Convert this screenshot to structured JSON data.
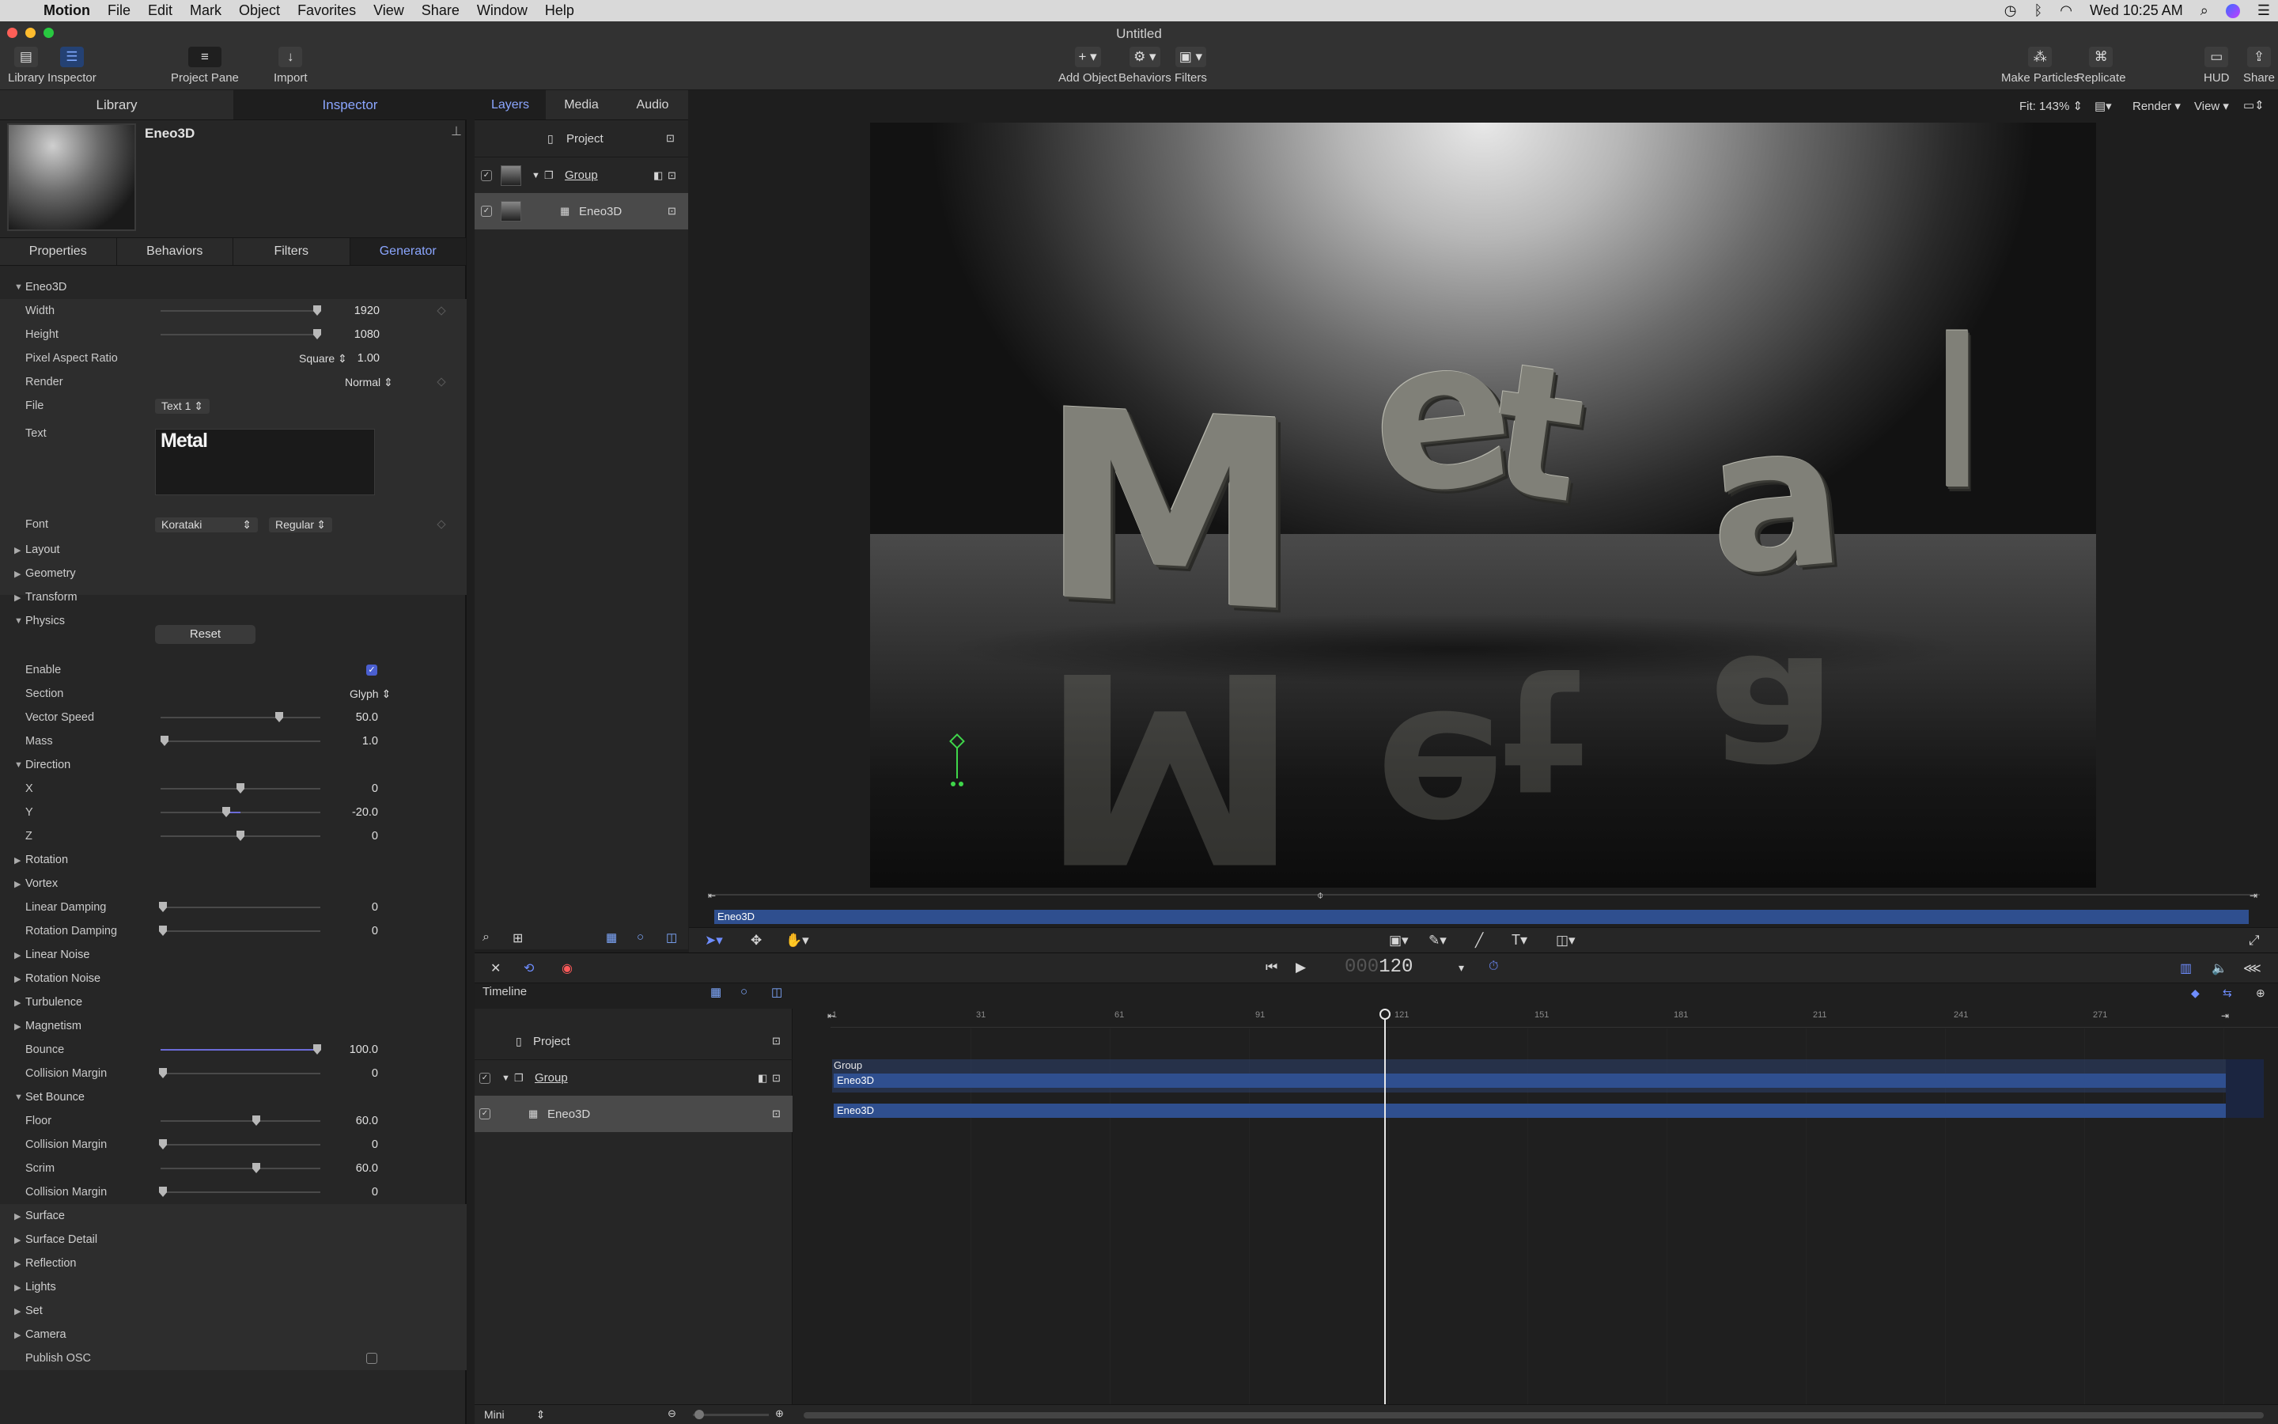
{
  "menubar": {
    "app_name": "Motion",
    "items": [
      "File",
      "Edit",
      "Mark",
      "Object",
      "Favorites",
      "View",
      "Share",
      "Window",
      "Help"
    ],
    "clock": "Wed 10:25 AM"
  },
  "window": {
    "title": "Untitled"
  },
  "toolbar": {
    "library": "Library",
    "inspector": "Inspector",
    "project_pane": "Project Pane",
    "import": "Import",
    "add_object": "Add Object",
    "behaviors": "Behaviors",
    "filters": "Filters",
    "make_particles": "Make Particles",
    "replicate": "Replicate",
    "hud": "HUD",
    "share": "Share"
  },
  "left_panel": {
    "tabs": [
      "Library",
      "Inspector"
    ],
    "preview_title": "Eneo3D",
    "inspector_tabs": [
      "Properties",
      "Behaviors",
      "Filters",
      "Generator"
    ],
    "section": "Eneo3D",
    "width_label": "Width",
    "width_value": "1920",
    "height_label": "Height",
    "height_value": "1080",
    "par_label": "Pixel Aspect Ratio",
    "par_popup": "Square",
    "par_value": "1.00",
    "render_label": "Render",
    "render_value": "Normal",
    "file_label": "File",
    "file_value": "Text 1",
    "text_label": "Text",
    "text_value": "Metal",
    "font_label": "Font",
    "font_family": "Korataki",
    "font_style": "Regular",
    "groups1": [
      "Layout",
      "Geometry",
      "Transform"
    ],
    "physics": "Physics",
    "reset": "Reset",
    "enable_label": "Enable",
    "section_label": "Section",
    "section_value": "Glyph",
    "vector_speed_label": "Vector Speed",
    "vector_speed_value": "50.0",
    "mass_label": "Mass",
    "mass_value": "1.0",
    "direction": "Direction",
    "x_label": "X",
    "x_value": "0",
    "y_label": "Y",
    "y_value": "-20.0",
    "z_label": "Z",
    "z_value": "0",
    "rotation": "Rotation",
    "vortex": "Vortex",
    "linear_damping_label": "Linear Damping",
    "linear_damping_value": "0",
    "rotation_damping_label": "Rotation Damping",
    "rotation_damping_value": "0",
    "groups2": [
      "Linear Noise",
      "Rotation Noise",
      "Turbulence",
      "Magnetism"
    ],
    "bounce_label": "Bounce",
    "bounce_value": "100.0",
    "collision_margin_label": "Collision Margin",
    "collision_margin_value": "0",
    "set_bounce": "Set Bounce",
    "floor_label": "Floor",
    "floor_value": "60.0",
    "floor_cm_value": "0",
    "scrim_label": "Scrim",
    "scrim_value": "60.0",
    "scrim_cm_value": "0",
    "groups3": [
      "Surface",
      "Surface Detail",
      "Reflection",
      "Lights",
      "Set",
      "Camera"
    ],
    "publish_osc": "Publish OSC"
  },
  "layers_pane": {
    "tabs": [
      "Layers",
      "Media",
      "Audio"
    ],
    "project": "Project",
    "group": "Group",
    "layer": "Eneo3D"
  },
  "canvas": {
    "fit": "Fit: 143%",
    "render": "Render",
    "view": "View",
    "letters": [
      "M",
      "e",
      "t",
      "a",
      "l"
    ],
    "clip_label": "Eneo3D"
  },
  "transport": {
    "timecode_dim": "000",
    "timecode": "120"
  },
  "timeline": {
    "title": "Timeline",
    "project": "Project",
    "group": "Group",
    "layer": "Eneo3D",
    "ruler_ticks": [
      "1",
      "31",
      "61",
      "91",
      "121",
      "151",
      "181",
      "211",
      "241",
      "271"
    ],
    "bar_group": "Group",
    "bar_group_layer": "Eneo3D",
    "bar_layer": "Eneo3D",
    "mini": "Mini"
  }
}
